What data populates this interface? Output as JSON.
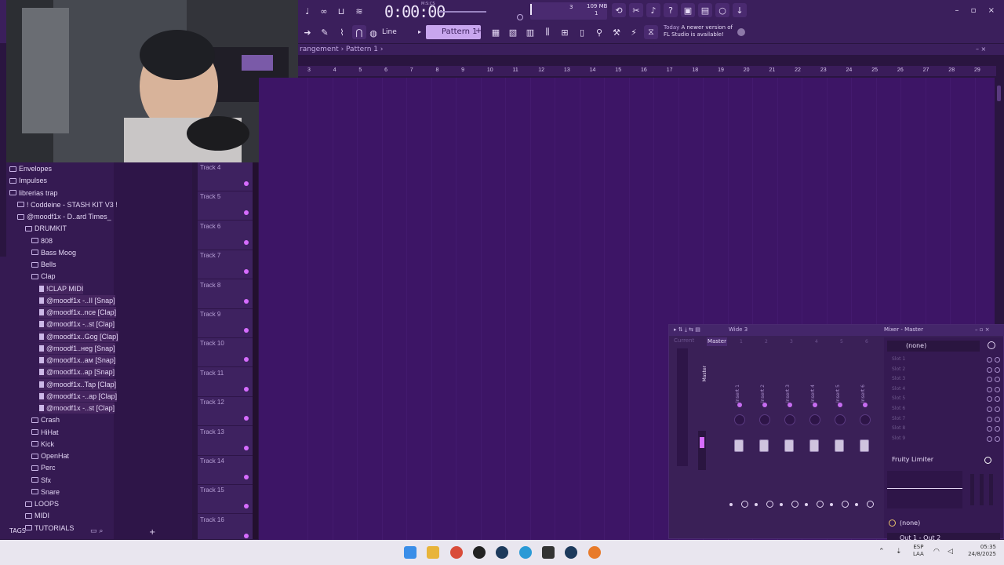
{
  "toolbar": {
    "time": "0:00:00",
    "time_unit": "M:S:CS",
    "mem_value": "3",
    "mem_label": "109 MB",
    "mem_label2": "1",
    "snap": "Line",
    "pattern": "Pattern 1",
    "news_today": "Today",
    "news_text1": "A newer version of",
    "news_text2": "FL Studio is available!"
  },
  "playlist": {
    "breadcrumb": "rangement › Pattern 1 ›",
    "ruler": [
      "3",
      "4",
      "5",
      "6",
      "7",
      "8",
      "9",
      "10",
      "11",
      "12",
      "13",
      "14",
      "15",
      "16",
      "17",
      "18",
      "19",
      "20",
      "21",
      "22",
      "23",
      "24",
      "25",
      "26",
      "27",
      "28",
      "29"
    ]
  },
  "browser": {
    "items": [
      {
        "label": "Envelopes",
        "depth": 0,
        "type": "folder"
      },
      {
        "label": "Impulses",
        "depth": 0,
        "type": "folder"
      },
      {
        "label": "librerias trap",
        "depth": 0,
        "type": "folder"
      },
      {
        "label": "! Coddeine - STASH KIT V3 !",
        "depth": 1,
        "type": "folder"
      },
      {
        "label": "@moodf1x - D..ard Times_",
        "depth": 1,
        "type": "folder"
      },
      {
        "label": "DRUMKIT",
        "depth": 2,
        "type": "folder"
      },
      {
        "label": "808",
        "depth": 3,
        "type": "folder"
      },
      {
        "label": "Bass Moog",
        "depth": 3,
        "type": "folder"
      },
      {
        "label": "Bells",
        "depth": 3,
        "type": "folder"
      },
      {
        "label": "Clap",
        "depth": 3,
        "type": "folder"
      },
      {
        "label": "!CLAP MIDI",
        "depth": 4,
        "type": "file"
      },
      {
        "label": "@moodf1x -..II [Snap]",
        "depth": 4,
        "type": "file"
      },
      {
        "label": "@moodf1x..nce [Clap]",
        "depth": 4,
        "type": "file"
      },
      {
        "label": "@moodf1x -..st [Clap]",
        "depth": 4,
        "type": "file"
      },
      {
        "label": "@moodf1x..Gog [Clap]",
        "depth": 4,
        "type": "file"
      },
      {
        "label": "@moodf1..неg [Snap]",
        "depth": 4,
        "type": "file"
      },
      {
        "label": "@moodf1x..aм [Snap]",
        "depth": 4,
        "type": "file"
      },
      {
        "label": "@moodf1x..ap [Snap]",
        "depth": 4,
        "type": "file"
      },
      {
        "label": "@moodf1x..Tap [Clap]",
        "depth": 4,
        "type": "file"
      },
      {
        "label": "@moodf1x -..ap [Clap]",
        "depth": 4,
        "type": "file"
      },
      {
        "label": "@moodf1x -..st [Clap]",
        "depth": 4,
        "type": "file"
      },
      {
        "label": "Crash",
        "depth": 3,
        "type": "folder"
      },
      {
        "label": "HiHat",
        "depth": 3,
        "type": "folder"
      },
      {
        "label": "Kick",
        "depth": 3,
        "type": "folder"
      },
      {
        "label": "OpenHat",
        "depth": 3,
        "type": "folder"
      },
      {
        "label": "Perc",
        "depth": 3,
        "type": "folder"
      },
      {
        "label": "Sfx",
        "depth": 3,
        "type": "folder"
      },
      {
        "label": "Snare",
        "depth": 3,
        "type": "folder"
      },
      {
        "label": "LOOPS",
        "depth": 2,
        "type": "folder"
      },
      {
        "label": "MIDI",
        "depth": 2,
        "type": "folder"
      },
      {
        "label": "TUTORIALS",
        "depth": 2,
        "type": "folder"
      }
    ],
    "tags": "TAGS"
  },
  "tracks": [
    "Track 4",
    "Track 5",
    "Track 6",
    "Track 7",
    "Track 8",
    "Track 9",
    "Track 10",
    "Track 11",
    "Track 12",
    "Track 13",
    "Track 14",
    "Track 15",
    "Track 16"
  ],
  "mixer": {
    "title": "Mixer - Master",
    "wide": "Wide 3",
    "current": "Current",
    "master": "Master",
    "strips": [
      "Master",
      "Insert 1",
      "Insert 2",
      "Insert 3",
      "Insert 4",
      "Insert 5",
      "Insert 6"
    ],
    "header_nums": [
      "1",
      "2",
      "3",
      "4",
      "5",
      "6"
    ],
    "effects_none": "(none)",
    "slots": [
      "Slot 1",
      "Slot 2",
      "Slot 3",
      "Slot 4",
      "Slot 5",
      "Slot 6",
      "Slot 7",
      "Slot 8",
      "Slot 9"
    ],
    "limiter": "Fruity Limiter",
    "bottom_none": "(none)",
    "output": "Out 1 - Out 2"
  },
  "taskbar": {
    "lang1": "ESP",
    "lang2": "LAA",
    "time": "05:35",
    "date": "24/8/2025"
  },
  "colors": {
    "accent": "#d66cff",
    "bg_playlist": "#3d1566",
    "pattern_bg": "#c8a6ee"
  }
}
